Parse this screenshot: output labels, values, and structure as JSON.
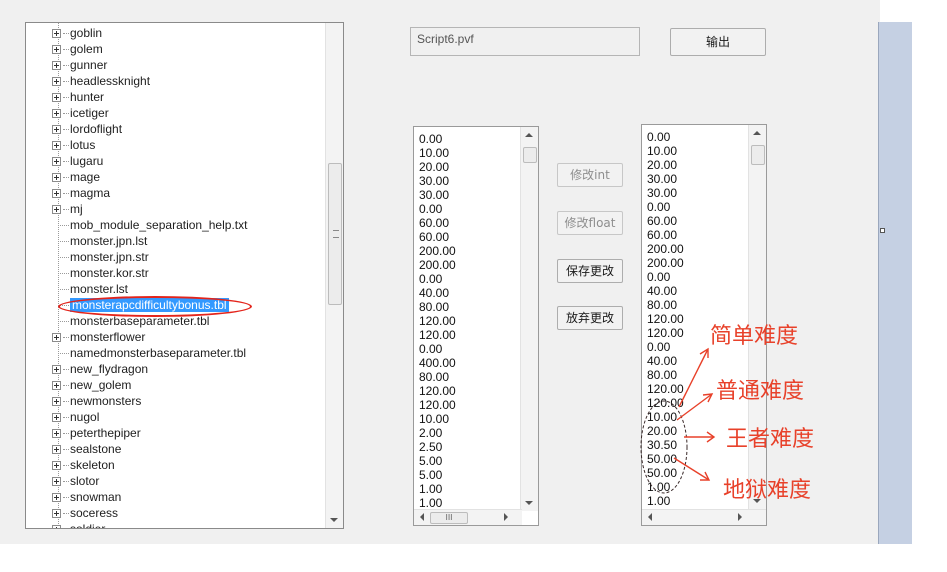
{
  "tree": {
    "items": [
      {
        "label": "goblin",
        "type": "folder"
      },
      {
        "label": "golem",
        "type": "folder"
      },
      {
        "label": "gunner",
        "type": "folder"
      },
      {
        "label": "headlessknight",
        "type": "folder"
      },
      {
        "label": "hunter",
        "type": "folder"
      },
      {
        "label": "icetiger",
        "type": "folder"
      },
      {
        "label": "lordoflight",
        "type": "folder"
      },
      {
        "label": "lotus",
        "type": "folder"
      },
      {
        "label": "lugaru",
        "type": "folder"
      },
      {
        "label": "mage",
        "type": "folder"
      },
      {
        "label": "magma",
        "type": "folder"
      },
      {
        "label": "mj",
        "type": "folder"
      },
      {
        "label": "mob_module_separation_help.txt",
        "type": "file"
      },
      {
        "label": "monster.jpn.lst",
        "type": "file"
      },
      {
        "label": "monster.jpn.str",
        "type": "file"
      },
      {
        "label": "monster.kor.str",
        "type": "file"
      },
      {
        "label": "monster.lst",
        "type": "file"
      },
      {
        "label": "monsterapcdifficultybonus.tbl",
        "type": "file",
        "selected": true
      },
      {
        "label": "monsterbaseparameter.tbl",
        "type": "file"
      },
      {
        "label": "monsterflower",
        "type": "folder"
      },
      {
        "label": "namedmonsterbaseparameter.tbl",
        "type": "file"
      },
      {
        "label": "new_flydragon",
        "type": "folder"
      },
      {
        "label": "new_golem",
        "type": "folder"
      },
      {
        "label": "newmonsters",
        "type": "folder"
      },
      {
        "label": "nugol",
        "type": "folder"
      },
      {
        "label": "peterthepiper",
        "type": "folder"
      },
      {
        "label": "sealstone",
        "type": "folder"
      },
      {
        "label": "skeleton",
        "type": "folder"
      },
      {
        "label": "slotor",
        "type": "folder"
      },
      {
        "label": "snowman",
        "type": "folder"
      },
      {
        "label": "soceress",
        "type": "folder"
      },
      {
        "label": "soldier",
        "type": "folder"
      }
    ]
  },
  "file_name": "Script6.pvf",
  "buttons": {
    "export": "输出",
    "edit_int": "修改int",
    "edit_float": "修改float",
    "save": "保存更改",
    "discard": "放弃更改"
  },
  "list_left": [
    "0.00",
    "10.00",
    "20.00",
    "30.00",
    "30.00",
    "0.00",
    "60.00",
    "60.00",
    "200.00",
    "200.00",
    "0.00",
    "40.00",
    "80.00",
    "120.00",
    "120.00",
    "0.00",
    "400.00",
    "80.00",
    "120.00",
    "120.00",
    "10.00",
    "2.00",
    "2.50",
    "5.00",
    "5.00",
    "1.00",
    "1.00"
  ],
  "list_right": [
    "0.00",
    "10.00",
    "20.00",
    "30.00",
    "30.00",
    "0.00",
    "60.00",
    "60.00",
    "200.00",
    "200.00",
    "0.00",
    "40.00",
    "80.00",
    "120.00",
    "120.00",
    "0.00",
    "40.00",
    "80.00",
    "120.00",
    "120.00",
    "10.00",
    "20.00",
    "30.50",
    "50.00",
    "50.00",
    "1.00",
    "1.00"
  ],
  "annotations": {
    "easy": "简单难度",
    "normal": "普通难度",
    "king": "王者难度",
    "hell": "地狱难度",
    "color": "#e8412a"
  },
  "colors": {
    "selection": "#3399ff",
    "highlight_ellipse": "#e3241b"
  },
  "scrollbar_hthumb_label": "III",
  "icons": [
    "tree-expand-icon",
    "scroll-up-icon",
    "scroll-down-icon",
    "scroll-left-icon",
    "scroll-right-icon"
  ]
}
